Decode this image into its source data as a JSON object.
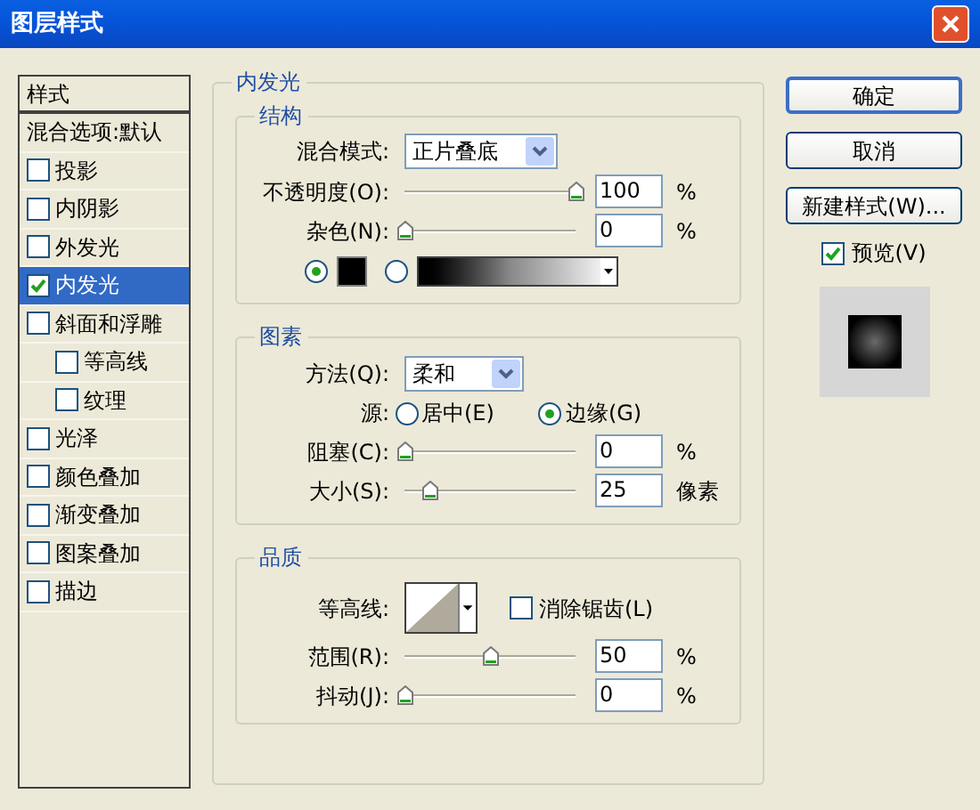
{
  "window": {
    "title": "图层样式"
  },
  "styles_list": {
    "header": "样式",
    "items": [
      {
        "label": "混合选项:默认",
        "kind": "plain",
        "selected": false
      },
      {
        "label": "投影",
        "kind": "check",
        "checked": false,
        "selected": false
      },
      {
        "label": "内阴影",
        "kind": "check",
        "checked": false,
        "selected": false
      },
      {
        "label": "外发光",
        "kind": "check",
        "checked": false,
        "selected": false
      },
      {
        "label": "内发光",
        "kind": "check",
        "checked": true,
        "selected": true
      },
      {
        "label": "斜面和浮雕",
        "kind": "check",
        "checked": false,
        "selected": false,
        "children": [
          {
            "label": "等高线",
            "kind": "check",
            "checked": false,
            "selected": false
          },
          {
            "label": "纹理",
            "kind": "check",
            "checked": false,
            "selected": false
          }
        ]
      },
      {
        "label": "光泽",
        "kind": "check",
        "checked": false,
        "selected": false
      },
      {
        "label": "颜色叠加",
        "kind": "check",
        "checked": false,
        "selected": false
      },
      {
        "label": "渐变叠加",
        "kind": "check",
        "checked": false,
        "selected": false
      },
      {
        "label": "图案叠加",
        "kind": "check",
        "checked": false,
        "selected": false
      },
      {
        "label": "描边",
        "kind": "check",
        "checked": false,
        "selected": false
      }
    ]
  },
  "panel": {
    "title": "内发光",
    "structure": {
      "title": "结构",
      "blend_mode": {
        "label": "混合模式:",
        "value": "正片叠底"
      },
      "opacity": {
        "label": "不透明度(O):",
        "level": 1,
        "value": "100",
        "unit": "%"
      },
      "noise": {
        "label": "杂色(N):",
        "level": 0,
        "value": "0",
        "unit": "%"
      },
      "fill_options": [
        {
          "kind": "color",
          "selected": true,
          "color": "#000000"
        },
        {
          "kind": "gradient",
          "selected": false
        }
      ]
    },
    "elements": {
      "title": "图素",
      "technique": {
        "label": "方法(Q):",
        "value": "柔和"
      },
      "source": {
        "label": "源:",
        "options": [
          {
            "label": "居中(E)",
            "selected": false
          },
          {
            "label": "边缘(G)",
            "selected": true
          }
        ]
      },
      "choke": {
        "label": "阻塞(C):",
        "level": 0,
        "value": "0",
        "unit": "%"
      },
      "size": {
        "label": "大小(S):",
        "level": 0.15,
        "value": "25",
        "unit": "像素"
      }
    },
    "quality": {
      "title": "品质",
      "contour": {
        "label": "等高线:"
      },
      "anti_alias": {
        "label": "消除锯齿(L)",
        "checked": false
      },
      "range": {
        "label": "范围(R):",
        "level": 0.5,
        "value": "50",
        "unit": "%"
      },
      "jitter": {
        "label": "抖动(J):",
        "level": 0,
        "value": "0",
        "unit": "%"
      }
    }
  },
  "buttons": [
    {
      "label": "确定",
      "default": true
    },
    {
      "label": "取消",
      "default": false
    },
    {
      "label": "新建样式(W)...",
      "default": false
    }
  ],
  "preview": {
    "label": "预览(V)",
    "checked": true
  }
}
